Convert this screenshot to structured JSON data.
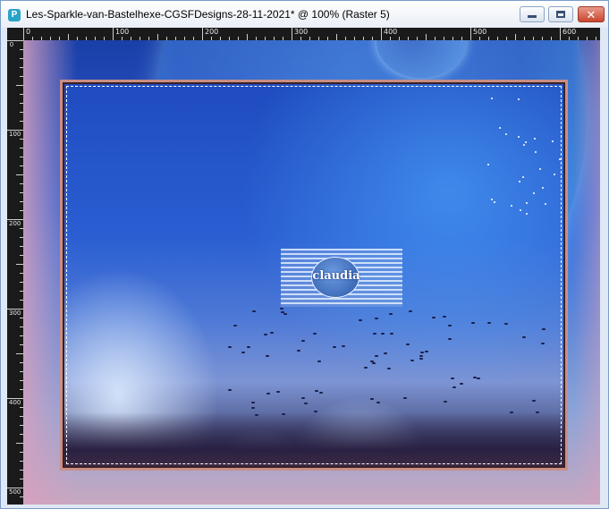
{
  "window": {
    "title": "Les-Sparkle-van-Bastelhexe-CGSFDesigns-28-11-2021* @ 100% (Raster 5)",
    "app_icon": "psp-app-icon",
    "controls": {
      "minimize_icon": "minimize-icon",
      "maximize_icon": "maximize-icon",
      "close_icon": "close-icon",
      "close_glyph": "✕"
    }
  },
  "ruler": {
    "top_labels": [
      "0",
      "100",
      "200",
      "300",
      "400",
      "500",
      "600"
    ],
    "left_labels": [
      "0",
      "100",
      "200",
      "300",
      "400",
      "500"
    ]
  },
  "canvas": {
    "watermark_text": "claudia",
    "colors": {
      "frame_outer": "#c98e86",
      "frame_inner": "#3a1f25",
      "sky_top": "#1a3fa8",
      "pink_edge": "#d6a0be"
    }
  }
}
